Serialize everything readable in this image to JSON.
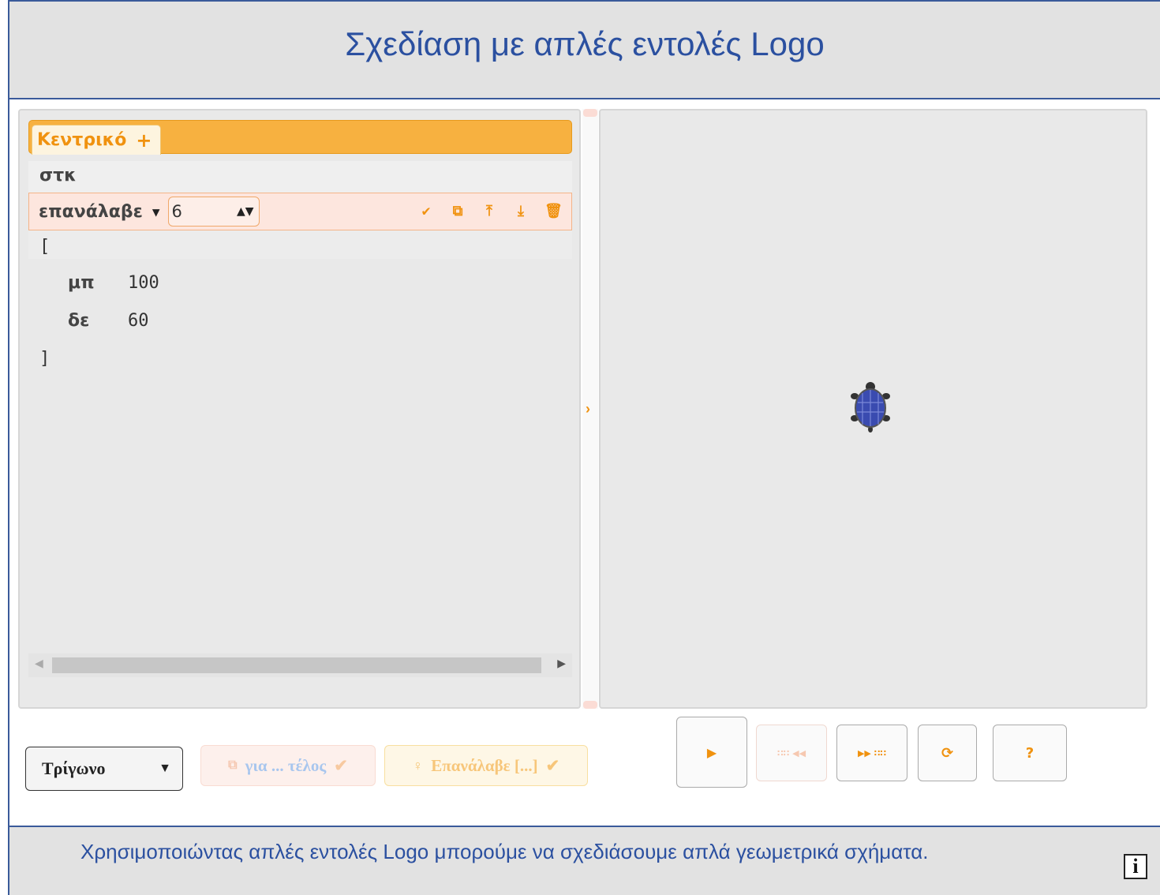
{
  "header": {
    "title": "Σχεδίαση με απλές εντολές Logo"
  },
  "editor": {
    "tab_label": "Κεντρικό",
    "tab_add": "+",
    "line_clear": "στκ",
    "repeat_keyword": "επανάλαβε",
    "repeat_count": "6",
    "open_bracket": "[",
    "fd_keyword": "μπ",
    "fd_value": "100",
    "rt_keyword": "δε",
    "rt_value": "60",
    "close_bracket": "]"
  },
  "controls": {
    "shape_select": "Τρίγωνο",
    "snippet_function": "για ... τέλος",
    "snippet_repeat": "Επανάλαβε [...]",
    "help_label": "?"
  },
  "footer": {
    "description": "Χρησιμοποιώντας απλές εντολές Logo μπορούμε να σχεδιάσουμε απλά γεωμετρικά σχήματα.",
    "info_label": "i"
  },
  "icons": {
    "dropdown": "caret-down-icon",
    "check": "check-icon",
    "copy": "copy-icon",
    "move_up": "move-up-icon",
    "move_down": "move-down-icon",
    "delete": "trash-icon",
    "run": "play-icon",
    "step_back": "step-back-icon",
    "step_forward": "step-forward-icon",
    "reset": "reset-icon",
    "turtle": "turtle-icon"
  },
  "colors": {
    "accent": "#f0920f",
    "title_blue": "#2b50a0",
    "turtle": "#3a4bb0"
  }
}
